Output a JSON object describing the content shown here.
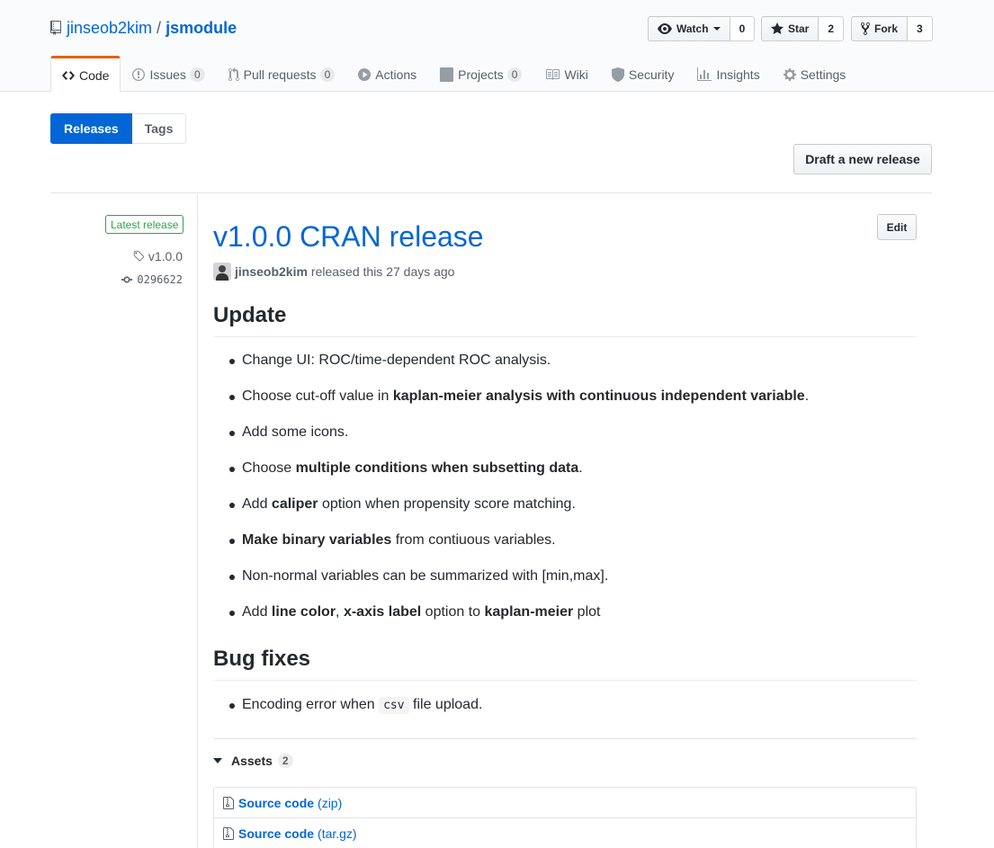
{
  "repo": {
    "owner": "jinseob2kim",
    "separator": "/",
    "name": "jsmodule"
  },
  "actions": {
    "watch": {
      "label": "Watch",
      "count": "0"
    },
    "star": {
      "label": "Star",
      "count": "2"
    },
    "fork": {
      "label": "Fork",
      "count": "3"
    }
  },
  "nav": [
    {
      "label": "Code",
      "icon": "code-icon"
    },
    {
      "label": "Issues",
      "icon": "issue-icon",
      "count": "0"
    },
    {
      "label": "Pull requests",
      "icon": "pull-request-icon",
      "count": "0"
    },
    {
      "label": "Actions",
      "icon": "play-icon"
    },
    {
      "label": "Projects",
      "icon": "project-icon",
      "count": "0"
    },
    {
      "label": "Wiki",
      "icon": "book-icon"
    },
    {
      "label": "Security",
      "icon": "shield-icon"
    },
    {
      "label": "Insights",
      "icon": "graph-icon"
    },
    {
      "label": "Settings",
      "icon": "gear-icon"
    }
  ],
  "subnav": {
    "releases": "Releases",
    "tags": "Tags"
  },
  "draft_button": "Draft a new release",
  "release": {
    "latest_label": "Latest release",
    "tag": "v1.0.0",
    "commit": "0296622",
    "title": "v1.0.0 CRAN release",
    "edit": "Edit",
    "author": "jinseob2kim",
    "released_text": "released this 27 days ago",
    "update_heading": "Update",
    "updates": {
      "i1": "Change UI: ROC/time-dependent ROC analysis.",
      "i2a": "Choose cut-off value in ",
      "i2b": "kaplan-meier analysis with continuous independent variable",
      "i2c": ".",
      "i3": "Add some icons.",
      "i4a": "Choose ",
      "i4b": "multiple conditions when subsetting data",
      "i4c": ".",
      "i5a": "Add ",
      "i5b": "caliper",
      "i5c": " option when propensity score matching.",
      "i6a": "Make binary variables",
      "i6b": " from contiuous variables.",
      "i7": "Non-normal variables can be summarized with [min,max].",
      "i8a": "Add ",
      "i8b": "line color",
      "i8c": ", ",
      "i8d": "x-axis label",
      "i8e": " option to ",
      "i8f": "kaplan-meier",
      "i8g": " plot"
    },
    "bugfix_heading": "Bug fixes",
    "bugfix": {
      "a": "Encoding error when ",
      "code": "csv",
      "b": " file upload."
    },
    "assets_label": "Assets",
    "assets_count": "2",
    "assets": [
      {
        "name": "Source code",
        "type": "(zip)"
      },
      {
        "name": "Source code",
        "type": "(tar.gz)"
      }
    ]
  },
  "colors": {
    "link": "#0366d6",
    "accent_tab": "#e36209",
    "latest_green": "#28a745"
  }
}
